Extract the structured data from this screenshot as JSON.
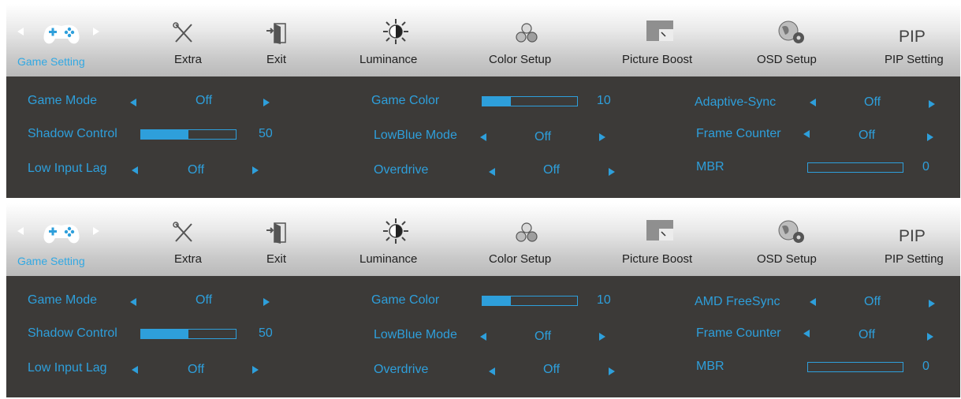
{
  "colors": {
    "accent": "#2e9fdb",
    "panel": "#3c3a38",
    "tab_text": "#1f1f1f"
  },
  "osd_top": {
    "tabs": [
      {
        "label": "Game Setting",
        "icon": "gamepad-icon"
      },
      {
        "label": "Extra",
        "icon": "tools-icon"
      },
      {
        "label": "Exit",
        "icon": "exit-door-icon"
      },
      {
        "label": "Luminance",
        "icon": "sun-icon"
      },
      {
        "label": "Color Setup",
        "icon": "color-circles-icon"
      },
      {
        "label": "Picture Boost",
        "icon": "picture-boost-icon"
      },
      {
        "label": "OSD Setup",
        "icon": "globe-gear-icon"
      },
      {
        "label": "PIP Setting",
        "icon": "pip-icon",
        "icon_text": "PIP"
      }
    ],
    "game_mode": {
      "label": "Game Mode",
      "value": "Off"
    },
    "shadow_control": {
      "label": "Shadow Control",
      "value": "50",
      "level": 0.5
    },
    "low_input_lag": {
      "label": "Low Input Lag",
      "value": "Off"
    },
    "game_color": {
      "label": "Game Color",
      "value": "10",
      "level": 0.3
    },
    "lowblue_mode": {
      "label": "LowBlue Mode",
      "value": "Off"
    },
    "overdrive": {
      "label": "Overdrive",
      "value": "Off"
    },
    "sync": {
      "label": "Adaptive-Sync",
      "value": "Off"
    },
    "frame_counter": {
      "label": "Frame Counter",
      "value": "Off"
    },
    "mbr": {
      "label": "MBR",
      "value": "0",
      "level": 0
    }
  },
  "osd_bottom": {
    "tabs": [
      {
        "label": "Game Setting",
        "icon": "gamepad-icon"
      },
      {
        "label": "Extra",
        "icon": "tools-icon"
      },
      {
        "label": "Exit",
        "icon": "exit-door-icon"
      },
      {
        "label": "Luminance",
        "icon": "sun-icon"
      },
      {
        "label": "Color Setup",
        "icon": "color-circles-icon"
      },
      {
        "label": "Picture Boost",
        "icon": "picture-boost-icon"
      },
      {
        "label": "OSD Setup",
        "icon": "globe-gear-icon"
      },
      {
        "label": "PIP Setting",
        "icon": "pip-icon",
        "icon_text": "PIP"
      }
    ],
    "game_mode": {
      "label": "Game Mode",
      "value": "Off"
    },
    "shadow_control": {
      "label": "Shadow Control",
      "value": "50",
      "level": 0.5
    },
    "low_input_lag": {
      "label": "Low Input Lag",
      "value": "Off"
    },
    "game_color": {
      "label": "Game Color",
      "value": "10",
      "level": 0.3
    },
    "lowblue_mode": {
      "label": "LowBlue Mode",
      "value": "Off"
    },
    "overdrive": {
      "label": "Overdrive",
      "value": "Off"
    },
    "sync": {
      "label": "AMD FreeSync",
      "value": "Off"
    },
    "frame_counter": {
      "label": "Frame Counter",
      "value": "Off"
    },
    "mbr": {
      "label": "MBR",
      "value": "0",
      "level": 0
    }
  }
}
